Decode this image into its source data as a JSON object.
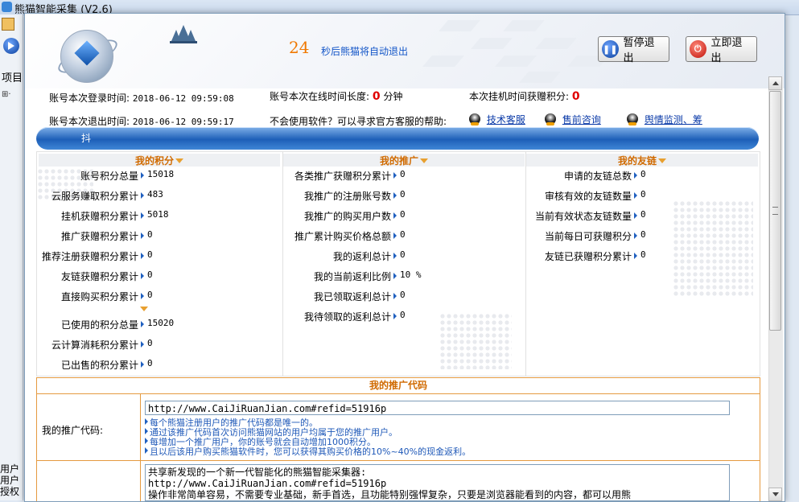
{
  "app": {
    "title": "熊猫智能采集 (V2.6)",
    "left_project": "项目",
    "left_user1": "用户",
    "left_user2": "用户",
    "left_auth": "授权"
  },
  "header": {
    "countdown": "24",
    "countdown_text": "秒后熊猫将自动退出",
    "pause_label": "暂停退出",
    "exit_label": "立即退出"
  },
  "info": {
    "login_label": "账号本次登录时间:",
    "login_time": "2018-06-12 09:59:08",
    "online_label": "账号本次在线时间长度:",
    "online_value": "0",
    "online_unit": "分钟",
    "hang_label": "本次挂机时间获赠积分:",
    "hang_value": "0",
    "logout_label": "账号本次退出时间:",
    "logout_time": "2018-06-12 09:59:17",
    "help_text": "不会使用软件？可以寻求官方客服的帮助:",
    "links": [
      "技术客服",
      "售前咨询",
      "舆情监测、筹"
    ]
  },
  "bluebar_text": "抖",
  "stats": {
    "points": {
      "title": "我的积分",
      "rows": [
        {
          "label": "账号积分总量",
          "value": "15018"
        },
        {
          "label": "云服务赚取积分累计",
          "value": "483"
        },
        {
          "label": "挂机获赠积分累计",
          "value": "5018"
        },
        {
          "label": "推广获赠积分累计",
          "value": "0"
        },
        {
          "label": "推荐注册获赠积分累计",
          "value": "0"
        },
        {
          "label": "友链获赠积分累计",
          "value": "0"
        },
        {
          "label": "直接购买积分累计",
          "value": "0"
        }
      ],
      "rows2": [
        {
          "label": "已使用的积分总量",
          "value": "15020"
        },
        {
          "label": "云计算消耗积分累计",
          "value": "0"
        },
        {
          "label": "已出售的积分累计",
          "value": "0"
        }
      ]
    },
    "promotion": {
      "title": "我的推广",
      "rows": [
        {
          "label": "各类推广获赠积分累计",
          "value": "0"
        },
        {
          "label": "我推广的注册账号数",
          "value": "0"
        },
        {
          "label": "我推广的购买用户数",
          "value": "0"
        },
        {
          "label": "推广累计购买价格总额",
          "value": "0"
        },
        {
          "label": "我的返利总计",
          "value": "0"
        },
        {
          "label": "我的当前返利比例",
          "value": "10 %"
        },
        {
          "label": "我已领取返利总计",
          "value": "0"
        },
        {
          "label": "我待领取的返利总计",
          "value": "0"
        }
      ]
    },
    "links": {
      "title": "我的友链",
      "rows": [
        {
          "label": "申请的友链总数",
          "value": "0"
        },
        {
          "label": "审核有效的友链数量",
          "value": "0"
        },
        {
          "label": "当前有效状态友链数量",
          "value": "0"
        },
        {
          "label": "当前每日可获赠积分",
          "value": "0"
        },
        {
          "label": "友链已获赠积分累计",
          "value": "0"
        }
      ]
    }
  },
  "promo": {
    "title": "我的推广代码",
    "code_label": "我的推广代码:",
    "code_value": "http://www.CaiJiRuanJian.com#refid=51916p",
    "notes": [
      "每个熊猫注册用户的推广代码都是唯一的。",
      "通过该推广代码首次访问熊猫网站的用户均属于您的推广用户。",
      "每增加一个推广用户，你的账号就会自动增加1000积分。",
      "且以后该用户购买熊猫软件时，您可以获得其购买价格的10%~40%的现金返利。"
    ],
    "share_text": "共享新发现的一个新一代智能化的熊猫智能采集器:\nhttp://www.CaiJiRuanJian.com#refid=51916p\n操作非常简单容易，不需要专业基础，新手首选，且功能特别强悍复杂，只要是浏览器能看到的内容，都可以用熊"
  },
  "colors": {
    "accent_orange": "#f07800",
    "title_orange": "#d06a00",
    "link_blue": "#0a3aa8",
    "value_red": "#e00000",
    "bar_blue": "#1d5fb8"
  }
}
